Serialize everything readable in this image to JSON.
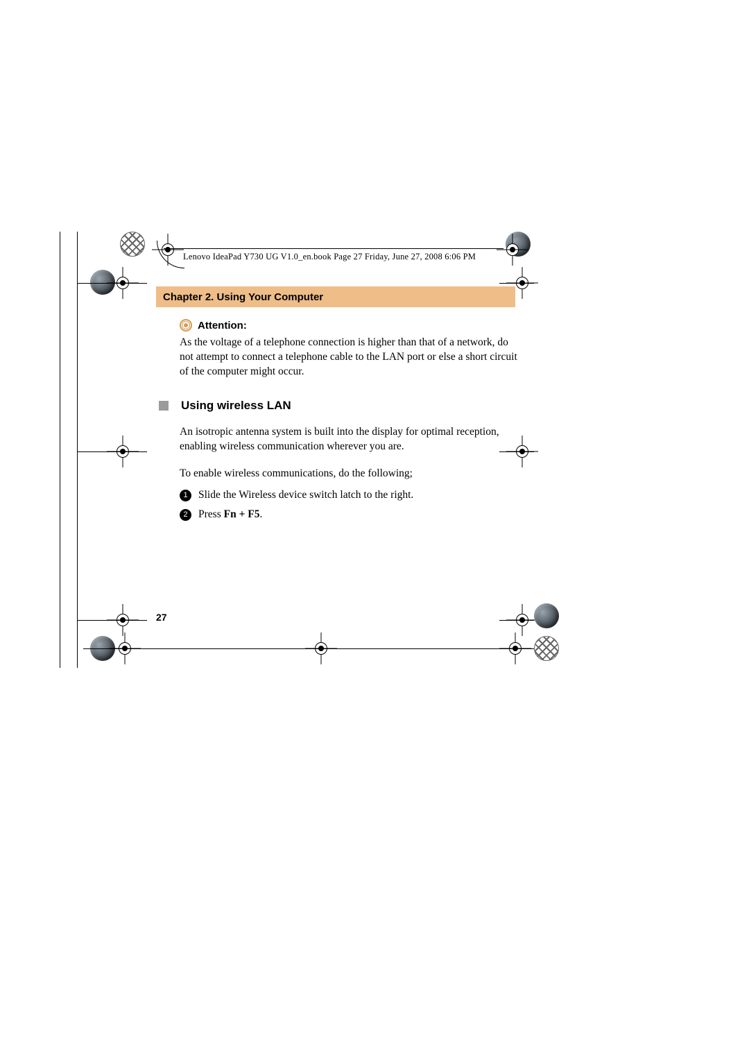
{
  "header_line": "Lenovo IdeaPad Y730 UG V1.0_en.book  Page 27  Friday, June 27, 2008  6:06 PM",
  "chapter_title": "Chapter 2. Using Your Computer",
  "attention": {
    "label": "Attention:",
    "body": "As the voltage of a telephone connection is higher than that of a network, do not attempt to connect a telephone cable to the LAN port or else a short circuit of the computer might occur."
  },
  "section": {
    "title": "Using wireless LAN",
    "intro": "An isotropic antenna system is built into the display for optimal reception, enabling wireless communication wherever you are.",
    "lead": "To enable wireless communications, do the following;",
    "steps": [
      {
        "n": "1",
        "text": "Slide the Wireless device switch latch to the right."
      },
      {
        "n": "2",
        "text_prefix": "Press ",
        "text_bold": "Fn + F5",
        "text_suffix": "."
      }
    ]
  },
  "page_number": "27"
}
